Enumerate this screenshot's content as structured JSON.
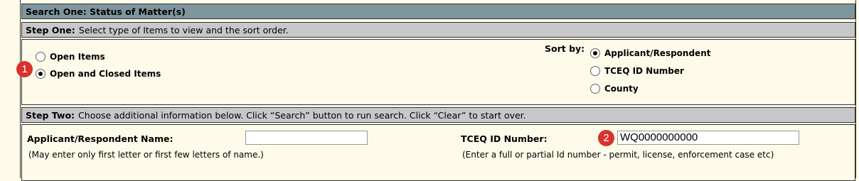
{
  "header": {
    "title": "Search One: Status of Matter(s)"
  },
  "step_one": {
    "label": "Step One:",
    "text": "Select type of Items to view and the sort order."
  },
  "items_filter": {
    "options": [
      {
        "label": "Open Items",
        "checked": false
      },
      {
        "label": "Open and Closed Items",
        "checked": true
      }
    ]
  },
  "sort": {
    "label": "Sort by:",
    "options": [
      {
        "label": "Applicant/Respondent",
        "checked": true
      },
      {
        "label": "TCEQ ID Number",
        "checked": false
      },
      {
        "label": "County",
        "checked": false
      }
    ]
  },
  "step_two": {
    "label": "Step Two:",
    "text": "Choose additional information below. Click “Search” button to run search. Click “Clear” to start over."
  },
  "applicant": {
    "label": "Applicant/Respondent Name:",
    "value": "",
    "hint": "(May enter only first letter or first few letters of name.)"
  },
  "tceq": {
    "label": "TCEQ ID Number:",
    "value": "WQ0000000000",
    "hint": "(Enter a full or partial Id number - permit, license, enforcement case etc)"
  },
  "badges": [
    "1",
    "2"
  ]
}
